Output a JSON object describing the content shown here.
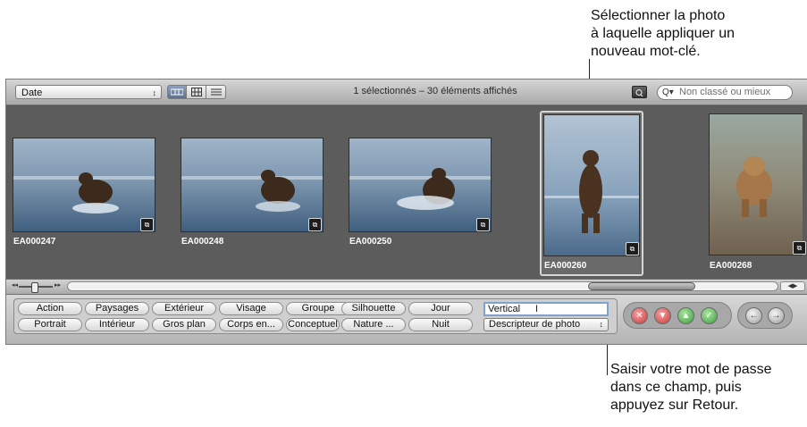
{
  "callouts": {
    "top": [
      "Sélectionner la photo",
      "à laquelle appliquer un",
      "nouveau mot-clé."
    ],
    "bottom": [
      "Saisir votre mot de passe",
      "dans ce champ, puis",
      "appuyez sur Retour."
    ]
  },
  "toolbar": {
    "sort_value": "Date",
    "status": "1 sélectionnés – 30 éléments affichés",
    "search_placeholder": "Non classé ou mieux"
  },
  "photos": [
    {
      "name": "EA000247",
      "pose": "running"
    },
    {
      "name": "EA000248",
      "pose": "running"
    },
    {
      "name": "EA000250",
      "pose": "running"
    },
    {
      "name": "EA000260",
      "pose": "standing",
      "selected": true
    },
    {
      "name": "EA000268",
      "pose": "walking"
    }
  ],
  "keyword_buttons": {
    "row1": [
      "Action",
      "Paysages",
      "Extérieur",
      "Visage",
      "Groupe",
      "Silhouette",
      "Jour"
    ],
    "row2": [
      "Portrait",
      "Intérieur",
      "Gros plan",
      "Corps en...",
      "Conceptuel",
      "Nature ...",
      "Nuit"
    ]
  },
  "keyword_input_value": "Vertical",
  "keyword_preset": "Descripteur de photo",
  "colors": {
    "browser_bg": "#5c5c5c",
    "selection_focus": "#7fa3cf",
    "reject": "#c83c3c",
    "approve": "#3c9f3c"
  }
}
